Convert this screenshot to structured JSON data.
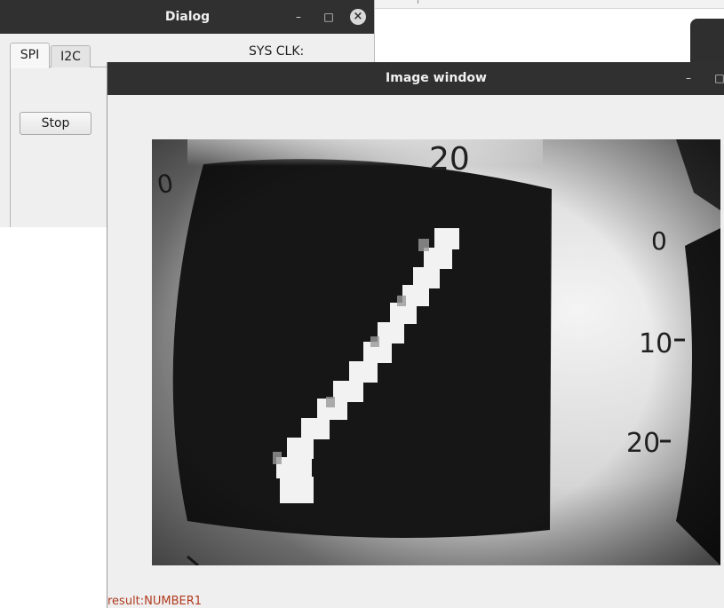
{
  "dialog": {
    "title": "Dialog",
    "minimize_glyph": "–",
    "maximize_glyph": "□",
    "close_glyph": "×",
    "tabs": [
      {
        "label": "SPI",
        "active": true
      },
      {
        "label": "I2C",
        "active": false
      }
    ],
    "stop_label": "Stop",
    "sys_clk_label": "SYS CLK:"
  },
  "image_window": {
    "title": "Image window",
    "minimize_glyph": "–",
    "maximize_glyph": "□",
    "camera_image": {
      "icon": "camera-feed-digit",
      "ticks_top": "20",
      "ticks_right": [
        "0",
        "10",
        "20"
      ],
      "ticks_left": "0"
    },
    "result_text": "result:NUMBER1"
  },
  "colors": {
    "titlebar": "#303030",
    "window_bg": "#efefef",
    "result_text": "#b03a1e"
  }
}
